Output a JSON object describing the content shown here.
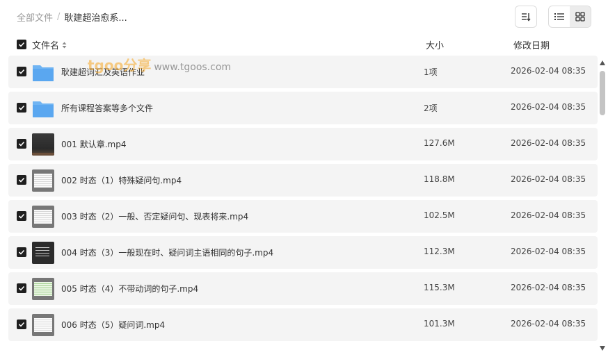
{
  "breadcrumb": {
    "root": "全部文件",
    "separator": "/",
    "current": "耿建超治愈系..."
  },
  "header": {
    "name": "文件名",
    "size": "大小",
    "date": "修改日期"
  },
  "watermark": {
    "logo": "tgoo分享",
    "url": "www.tgoos.com"
  },
  "files": [
    {
      "name": "耿建超词汇及英语作业",
      "size": "1项",
      "date": "2026-02-04 08:35",
      "icon": "folder-icon"
    },
    {
      "name": "所有课程答案等多个文件",
      "size": "2项",
      "date": "2026-02-04 08:35",
      "icon": "folder-icon"
    },
    {
      "name": "001 默认章.mp4",
      "size": "127.6M",
      "date": "2026-02-04 08:35",
      "icon": "video-thumbnail"
    },
    {
      "name": "002 时态（1）特殊疑问句.mp4",
      "size": "118.8M",
      "date": "2026-02-04 08:35",
      "icon": "video-thumbnail"
    },
    {
      "name": "003 时态（2）一般、否定疑问句、现表将来.mp4",
      "size": "102.5M",
      "date": "2026-02-04 08:35",
      "icon": "video-thumbnail"
    },
    {
      "name": "004 时态（3）一般现在时、疑问词主语相同的句子.mp4",
      "size": "112.3M",
      "date": "2026-02-04 08:35",
      "icon": "video-thumbnail"
    },
    {
      "name": "005 时态（4）不带动词的句子.mp4",
      "size": "115.3M",
      "date": "2026-02-04 08:35",
      "icon": "video-thumbnail"
    },
    {
      "name": "006 时态（5）疑问词.mp4",
      "size": "101.3M",
      "date": "2026-02-04 08:35",
      "icon": "video-thumbnail"
    }
  ],
  "colors": {
    "folder": "#5aa7f0",
    "row_bg": "#f4f4f4",
    "checkbox": "#1f1f1f",
    "watermark": "#f5a623"
  }
}
